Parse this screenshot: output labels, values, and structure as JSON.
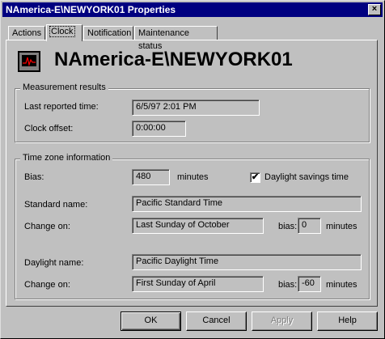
{
  "window": {
    "title": "NAmerica-E\\NEWYORK01 Properties",
    "close_glyph": "×"
  },
  "tabs": [
    "Actions",
    "Clock",
    "Notification",
    "Maintenance status"
  ],
  "active_tab": "Clock",
  "server_name": "NAmerica-E\\NEWYORK01",
  "measurement": {
    "legend": "Measurement results",
    "last_reported_label": "Last reported time:",
    "last_reported_value": "6/5/97  2:01 PM",
    "clock_offset_label": "Clock offset:",
    "clock_offset_value": "0:00:00"
  },
  "timezone": {
    "legend": "Time zone information",
    "bias_label": "Bias:",
    "bias_value": "480",
    "bias_units": "minutes",
    "daylight_checkbox_label": "Daylight savings time",
    "daylight_checked": true,
    "check_glyph": "✔",
    "standard_name_label": "Standard name:",
    "standard_name_value": "Pacific Standard Time",
    "std_change_label": "Change on:",
    "std_change_value": "Last Sunday of October",
    "std_bias_label": "bias:",
    "std_bias_value": "0",
    "std_bias_units": "minutes",
    "daylight_name_label": "Daylight name:",
    "daylight_name_value": "Pacific Daylight Time",
    "dl_change_label": "Change on:",
    "dl_change_value": "First Sunday of April",
    "dl_bias_label": "bias:",
    "dl_bias_value": "-60",
    "dl_bias_units": "minutes"
  },
  "buttons": {
    "ok": "OK",
    "cancel": "Cancel",
    "apply": "Apply",
    "help": "Help"
  }
}
